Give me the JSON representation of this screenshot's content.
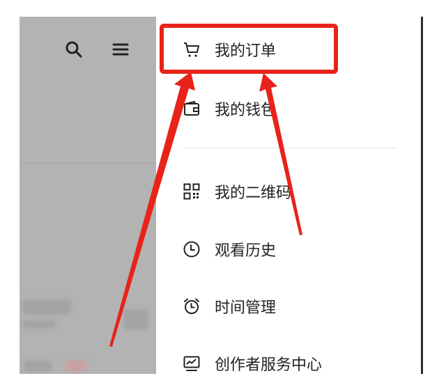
{
  "toolbar": {
    "icons": [
      "search-icon",
      "menu-icon"
    ]
  },
  "drawer": {
    "items": [
      {
        "label": "我的订单",
        "icon": "cart-icon"
      },
      {
        "label": "我的钱包",
        "icon": "wallet-icon"
      },
      {
        "label": "我的二维码",
        "icon": "qr-code-icon"
      },
      {
        "label": "观看历史",
        "icon": "clock-icon"
      },
      {
        "label": "时间管理",
        "icon": "alarm-clock-icon"
      },
      {
        "label": "创作者服务中心",
        "icon": "chart-monitor-icon"
      }
    ]
  },
  "annotation": {
    "highlight_color": "#e8231a",
    "highlighted_item": "我的订单"
  }
}
